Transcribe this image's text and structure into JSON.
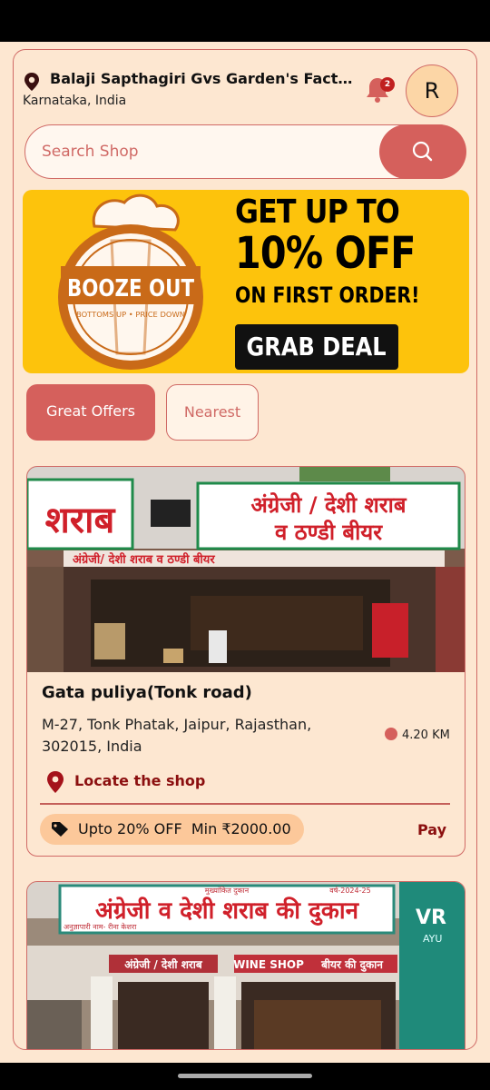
{
  "header": {
    "location_title": "Balaji Sapthagiri Gvs Garden's Factory, B...",
    "location_subtitle": "Karnataka, India",
    "notification_count": "2",
    "avatar_letter": "R"
  },
  "search": {
    "placeholder": "Search Shop"
  },
  "banner": {
    "logo_text": "BOOZE OUT",
    "logo_tagline": "BOTTOMS UP • PRICE DOWN",
    "line1": "GET UP TO",
    "line2": "10% OFF",
    "line3": "ON FIRST ORDER!",
    "cta": "GRAB DEAL"
  },
  "filters": [
    {
      "label": "Great Offers",
      "active": true
    },
    {
      "label": "Nearest",
      "active": false
    }
  ],
  "shops": [
    {
      "name": "Gata puliya(Tonk road)",
      "address": "M-27, Tonk Phatak, Jaipur, Rajasthan, 302015, India",
      "distance": "4.20 KM",
      "locate_label": "Locate the shop",
      "offer": "Upto 20% OFF",
      "min_order": "Min ₹2000.00",
      "pay_label": "Pay",
      "sign_left": "शराब",
      "sign_right_1": "अंग्रेजी / देशी शराब",
      "sign_right_2": "व ठण्डी बीयर",
      "sign_strip": "अंग्रेजी/ देशी शराब व ठण्डी बीयर"
    },
    {
      "sign_top": "अंग्रेजी व देशी शराब की दुकान",
      "sign_sub": "अनुज्ञापारी नाम- रीना केशरा",
      "sign_mid_left": "अंग्रेजी / देशी शराब",
      "sign_mid_center": "WINE SHOP",
      "sign_mid_right": "बीयर की दुकान",
      "sign_small_1": "मुख्यांकित दुकान",
      "sign_small_2": "वर्ष-2024-25",
      "side_sign_1": "VR",
      "side_sign_2": "AYU"
    }
  ],
  "colors": {
    "accent": "#d5605c",
    "background": "#fde7d1",
    "banner_yellow": "#fdc30c",
    "dark_red": "#8b0f0f"
  }
}
